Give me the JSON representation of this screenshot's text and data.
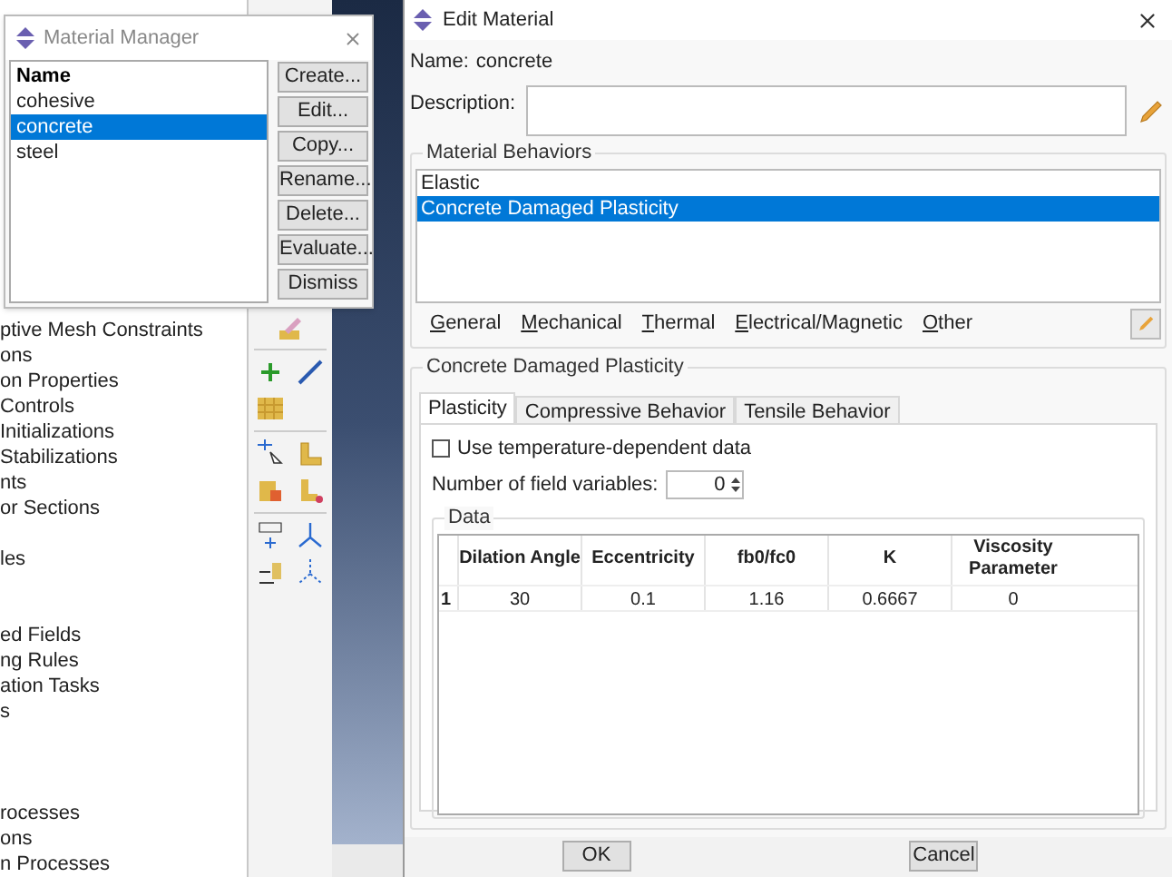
{
  "model_tree": {
    "items": [
      "ptive Mesh Constraints",
      "ons",
      "on Properties",
      "Controls",
      "Initializations",
      "Stabilizations",
      "nts",
      "or Sections",
      "les",
      "ed Fields",
      "ng Rules",
      "ation Tasks",
      "s",
      "rocesses",
      "ons",
      "n Processes"
    ]
  },
  "material_manager": {
    "title": "Material Manager",
    "list_header": "Name",
    "materials": [
      {
        "name": "cohesive",
        "selected": false
      },
      {
        "name": "concrete",
        "selected": true
      },
      {
        "name": "steel",
        "selected": false
      }
    ],
    "buttons": [
      "Create...",
      "Edit...",
      "Copy...",
      "Rename...",
      "Delete...",
      "Evaluate...",
      "Dismiss"
    ]
  },
  "edit_material": {
    "title": "Edit Material",
    "name_label": "Name:",
    "name_value": "concrete",
    "description_label": "Description:",
    "material_behaviors": {
      "title": "Material Behaviors",
      "items": [
        {
          "name": "Elastic",
          "selected": false
        },
        {
          "name": "Concrete Damaged Plasticity",
          "selected": true
        }
      ]
    },
    "menus": [
      "General",
      "Mechanical",
      "Thermal",
      "Electrical/Magnetic",
      "Other"
    ],
    "section": {
      "title": "Concrete Damaged Plasticity",
      "tabs": [
        {
          "label": "Plasticity",
          "selected": true
        },
        {
          "label": "Compressive Behavior",
          "selected": false
        },
        {
          "label": "Tensile Behavior",
          "selected": false
        }
      ],
      "temperature_dependent": {
        "label": "Use temperature-dependent data",
        "checked": false
      },
      "field_variables": {
        "label": "Number of field variables:",
        "value": "0"
      },
      "data": {
        "title": "Data",
        "columns": [
          "Dilation Angle",
          "Eccentricity",
          "fb0/fc0",
          "K",
          "Viscosity Parameter"
        ],
        "rows": [
          {
            "index": "1",
            "cells": [
              "30",
              "0.1",
              "1.16",
              "0.6667",
              "0"
            ]
          }
        ]
      }
    },
    "buttons": [
      "OK",
      "Cancel"
    ]
  }
}
